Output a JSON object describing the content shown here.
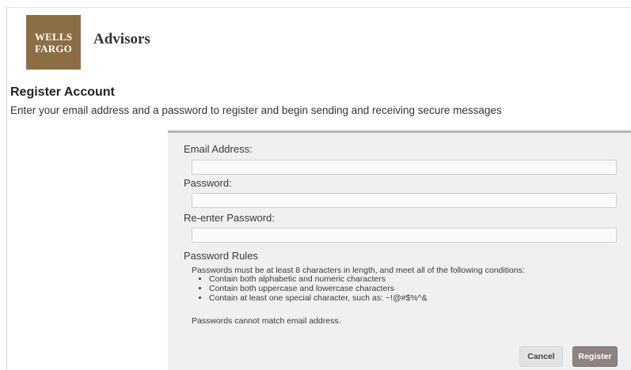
{
  "brand": {
    "logo_line1": "WELLS",
    "logo_line2": "FARGO",
    "suffix": "Advisors",
    "logo_color": "#8c6e44"
  },
  "page": {
    "title": "Register Account",
    "description": "Enter your email address and a password to register and begin sending and receiving secure messages"
  },
  "form": {
    "email_label": "Email Address:",
    "email_value": "",
    "password_label": "Password:",
    "password_value": "",
    "reenter_label": "Re-enter Password:",
    "reenter_value": ""
  },
  "rules": {
    "heading": "Password Rules",
    "intro": "Passwords must be at least 8 characters in length, and meet all of the following conditions:",
    "items": [
      "Contain both alphabetic and numeric characters",
      "Contain both uppercase and lowercase characters",
      "Contain at least one special character, such as: ~!@#$%^&"
    ],
    "note": "Passwords cannot match email address."
  },
  "buttons": {
    "cancel_label": "Cancel",
    "register_label": "Register",
    "register_color": "#8e8282"
  }
}
